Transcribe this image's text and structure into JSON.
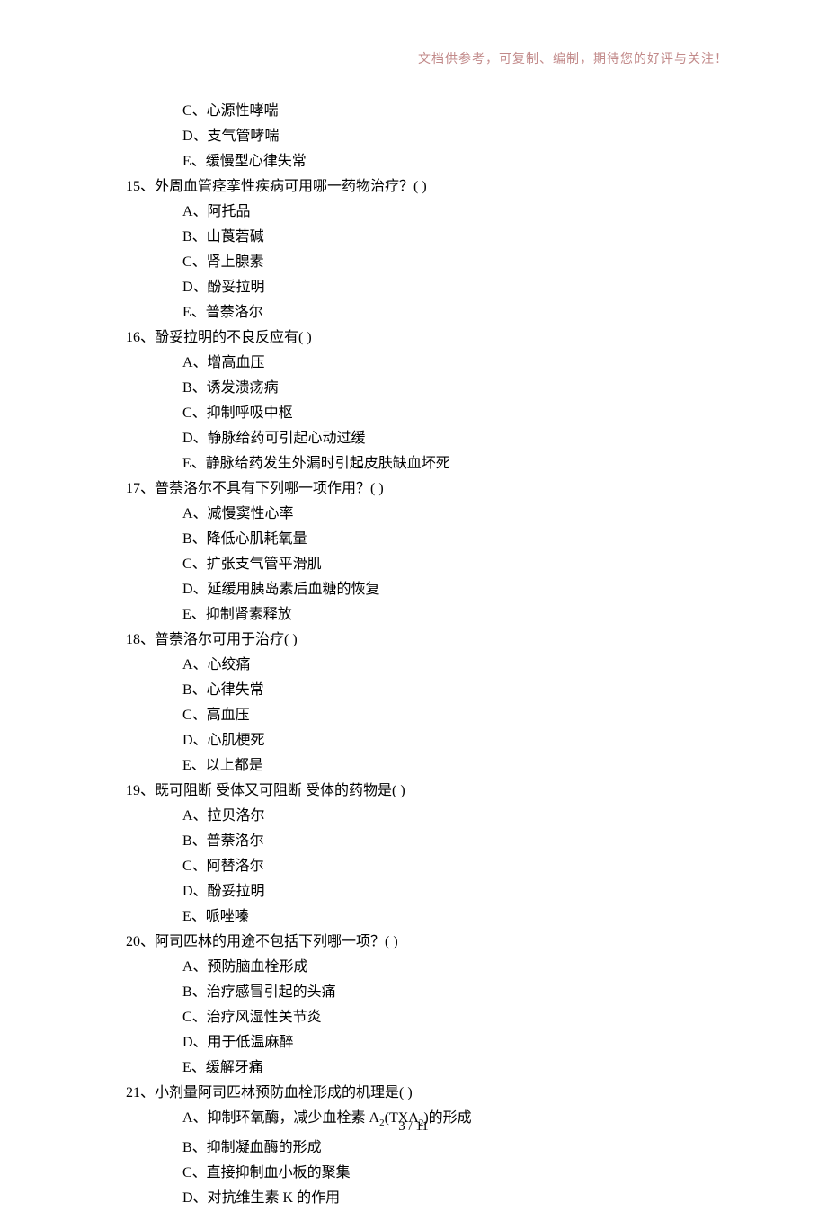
{
  "header_note": "文档供参考，可复制、编制，期待您的好评与关注！",
  "footer": "3  / 11",
  "partial_options_top": [
    "C、心源性哮喘",
    "D、支气管哮喘",
    "E、缓慢型心律失常"
  ],
  "questions": [
    {
      "num": "15、",
      "stem": "外周血管痉挛性疾病可用哪一药物治疗？(           )",
      "options": [
        "A、阿托品",
        "B、山莨菪碱",
        "C、肾上腺素",
        "D、酚妥拉明",
        "E、普萘洛尔"
      ]
    },
    {
      "num": "16、",
      "stem": "酚妥拉明的不良反应有(             )",
      "options": [
        "A、增高血压",
        "B、诱发溃疡病",
        "C、抑制呼吸中枢",
        "D、静脉给药可引起心动过缓",
        "E、静脉给药发生外漏时引起皮肤缺血坏死"
      ]
    },
    {
      "num": "17、",
      "stem": "普萘洛尔不具有下列哪一项作用？(            )",
      "options": [
        "A、减慢窦性心率",
        "B、降低心肌耗氧量",
        "C、扩张支气管平滑肌",
        "D、延缓用胰岛素后血糖的恢复",
        "E、抑制肾素释放"
      ]
    },
    {
      "num": "18、",
      "stem": "普萘洛尔可用于治疗(             )",
      "options": [
        "A、心绞痛",
        "B、心律失常",
        "C、高血压",
        "D、心肌梗死",
        "E、以上都是"
      ]
    },
    {
      "num": "19、",
      "stem": "既可阻断    受体又可阻断    受体的药物是(             )",
      "options": [
        "A、拉贝洛尔",
        "B、普萘洛尔",
        "C、阿替洛尔",
        "D、酚妥拉明",
        "E、哌唑嗪"
      ]
    },
    {
      "num": "20、",
      "stem": "阿司匹林的用途不包括下列哪一项？(            )",
      "options": [
        "A、预防脑血栓形成",
        "B、治疗感冒引起的头痛",
        "C、治疗风湿性关节炎",
        "D、用于低温麻醉",
        "E、缓解牙痛"
      ]
    },
    {
      "num": "21、",
      "stem": "小剂量阿司匹林预防血栓形成的机理是(             )",
      "options_special": true
    }
  ],
  "q21_options": {
    "a_pre": "A、抑制环氧酶，减少血栓素 A",
    "a_sub1": "2",
    "a_mid": "(TXA",
    "a_sub2": "2",
    "a_post": ")的形成",
    "b": "B、抑制凝血酶的形成",
    "c": "C、直接抑制血小板的聚集",
    "d": "D、对抗维生素 K 的作用"
  }
}
